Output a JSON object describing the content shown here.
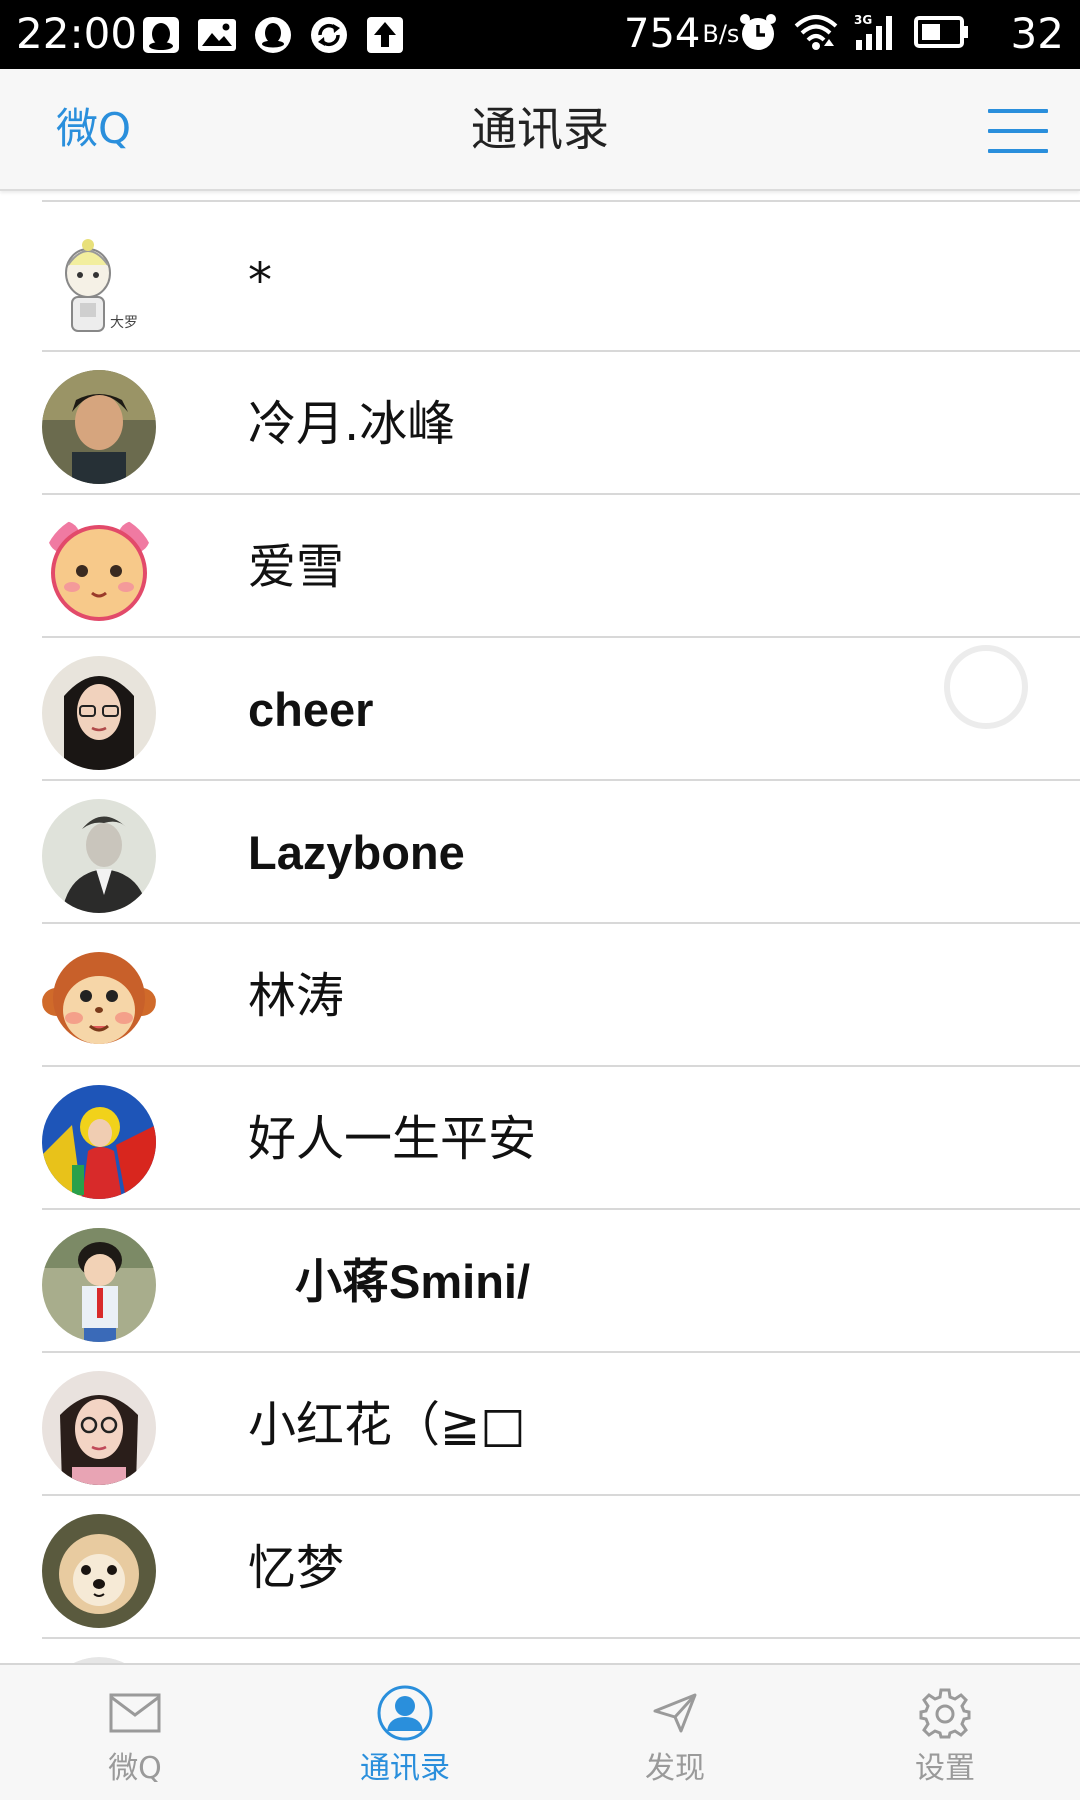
{
  "status_bar": {
    "time": "22:00",
    "net_speed": "754",
    "net_speed_unit": "B/s",
    "battery_level": "32",
    "left_icons": [
      "qq-penguin-icon",
      "gallery-icon",
      "qq-alt-icon",
      "sync-icon",
      "upload-icon"
    ],
    "right_icons": [
      "alarm-icon",
      "wifi-icon",
      "signal-3g-icon",
      "battery-icon"
    ]
  },
  "header": {
    "back_label": "微Q",
    "title": "通讯录",
    "menu_icon": "hamburger-menu-icon",
    "accent_color": "#2a8fdc"
  },
  "contacts": [
    {
      "name": "*",
      "avatar": "cartoon-girl-avatar"
    },
    {
      "name": "冷月.冰峰",
      "avatar": "photo-avatar"
    },
    {
      "name": "爱雪",
      "avatar": "cartoon-face-avatar"
    },
    {
      "name": "cheer",
      "avatar": "photo-avatar"
    },
    {
      "name": "Lazybone",
      "avatar": "photo-avatar"
    },
    {
      "name": "林涛",
      "avatar": "cartoon-monkey-avatar"
    },
    {
      "name": "好人一生平安",
      "avatar": "photo-avatar"
    },
    {
      "name": "　小蒋Smini/",
      "avatar": "photo-avatar"
    },
    {
      "name": "小红花（≧□",
      "avatar": "photo-avatar"
    },
    {
      "name": "忆梦",
      "avatar": "photo-dog-avatar"
    }
  ],
  "bottom_nav": [
    {
      "label": "微Q",
      "icon": "mail-envelope-icon",
      "active": false
    },
    {
      "label": "通讯录",
      "icon": "contact-person-icon",
      "active": true
    },
    {
      "label": "发现",
      "icon": "paper-plane-icon",
      "active": false
    },
    {
      "label": "设置",
      "icon": "gear-icon",
      "active": false
    }
  ]
}
